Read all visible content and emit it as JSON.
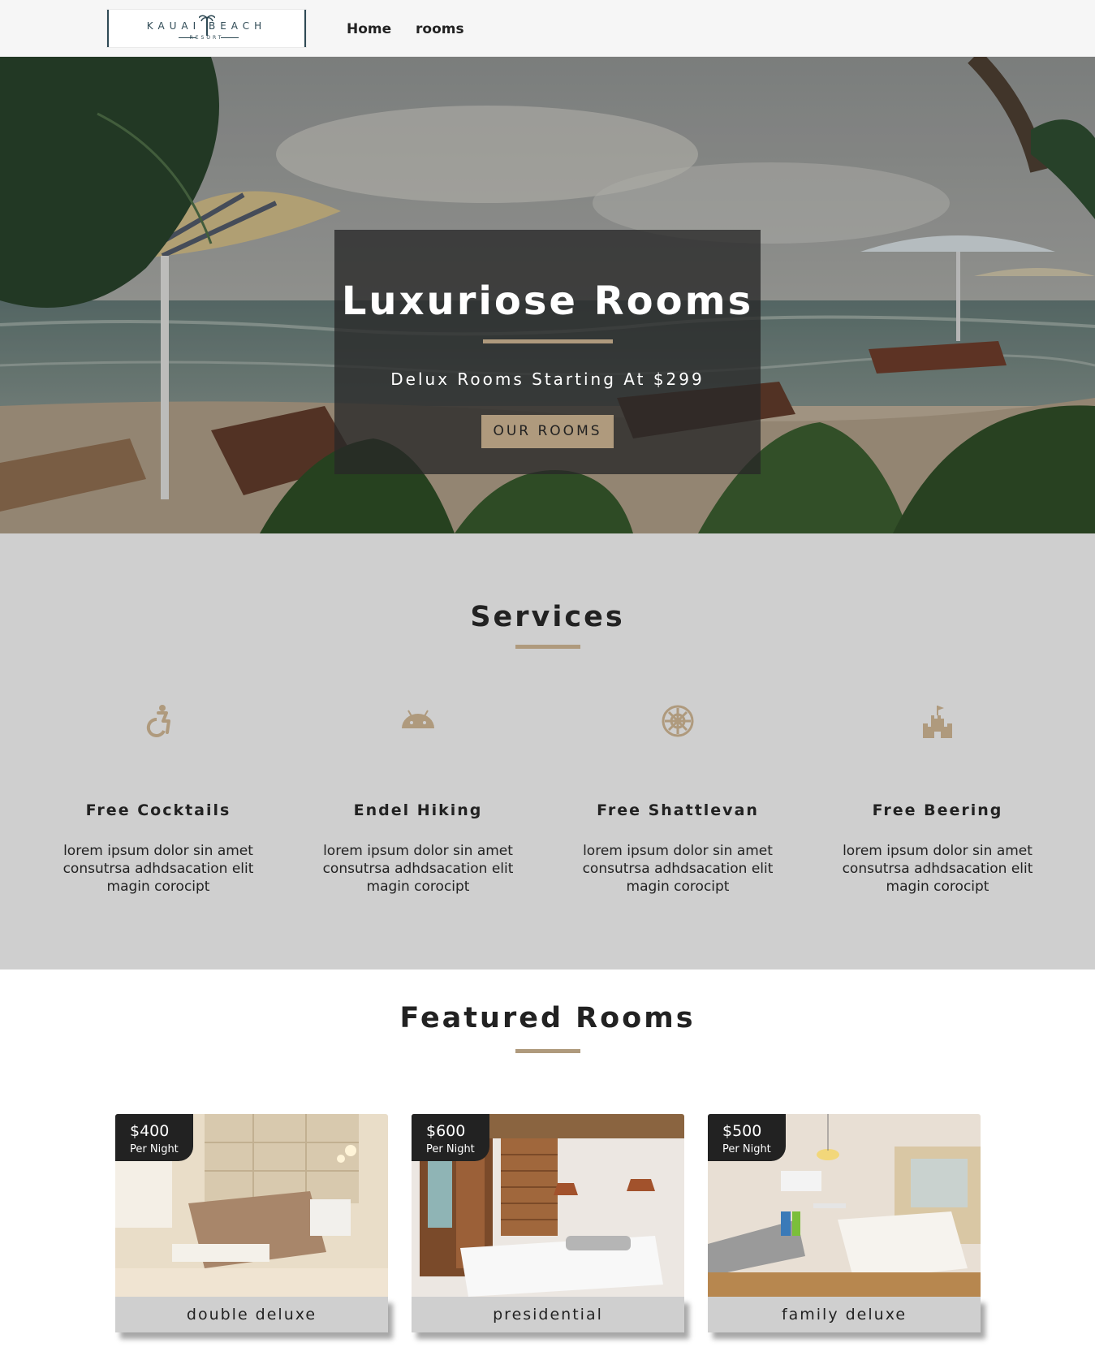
{
  "nav": {
    "logo": {
      "brand": "KAUAI BEACH",
      "sub": "RESORT"
    },
    "links": [
      "Home",
      "rooms"
    ]
  },
  "hero": {
    "title": "Luxuriose Rooms",
    "subtitle": "Delux Rooms Starting At $299",
    "button": "OUR ROOMS"
  },
  "services": {
    "title": "Services",
    "items": [
      {
        "icon": "accessibility-icon",
        "title": "Free Cocktails",
        "text": "lorem ipsum dolor sin amet consutrsa adhdsacation elit magin corocipt"
      },
      {
        "icon": "android-icon",
        "title": "Endel Hiking",
        "text": "lorem ipsum dolor sin amet consutrsa adhdsacation elit magin corocipt"
      },
      {
        "icon": "galactic-empire-icon",
        "title": "Free Shattlevan",
        "text": "lorem ipsum dolor sin amet consutrsa adhdsacation elit magin corocipt"
      },
      {
        "icon": "castle-icon",
        "title": "Free Beering",
        "text": "lorem ipsum dolor sin amet consutrsa adhdsacation elit magin corocipt"
      }
    ]
  },
  "featured": {
    "title": "Featured Rooms",
    "rooms": [
      {
        "price": "$400",
        "per": "Per Night",
        "name": "double deluxe"
      },
      {
        "price": "$600",
        "per": "Per Night",
        "name": "presidential"
      },
      {
        "price": "$500",
        "per": "Per Night",
        "name": "family deluxe"
      }
    ]
  },
  "colors": {
    "accent": "#af9a7d",
    "services_bg": "#cfcfcf",
    "dark": "#222222"
  }
}
